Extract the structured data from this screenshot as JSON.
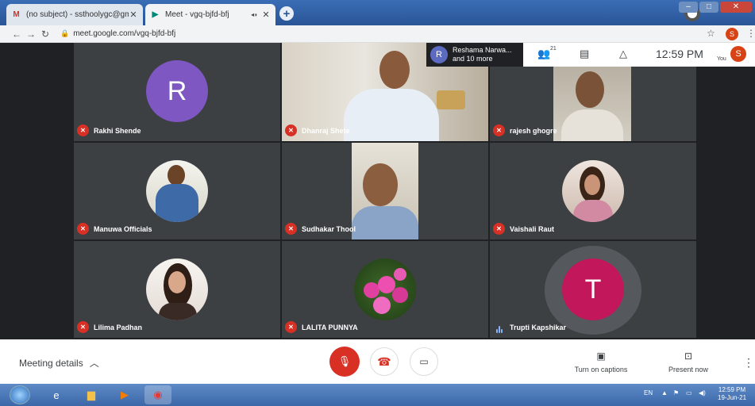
{
  "browser": {
    "tabs": [
      {
        "icon": "gmail-icon",
        "glyph": "M",
        "title": "(no subject) - ssthoolygc@gmail.",
        "close": "✕"
      },
      {
        "icon": "meet-icon",
        "glyph": "▶",
        "title": "Meet - vgq-bjfd-bfj",
        "close": "✕",
        "audio": "◂◗"
      }
    ],
    "new_tab": "+",
    "url": "meet.google.com/vgq-bjfd-bfj",
    "profile_initial": "S"
  },
  "meet": {
    "presenting": {
      "initial": "R",
      "line1": "Reshama Narwa...",
      "line2": "and 10 more"
    },
    "people_count": "21",
    "clock": "12:59 PM",
    "you_label": "You",
    "you_initial": "S",
    "participants": [
      {
        "name": "Rakhi Shende",
        "avatar": "R",
        "avatar_color": "#7e57c2",
        "muted": true
      },
      {
        "name": "Dhanraj Shete",
        "muted": true
      },
      {
        "name": "rajesh ghogre",
        "muted": true
      },
      {
        "name": "Manuwa Officials",
        "muted": true
      },
      {
        "name": "Sudhakar Thool",
        "muted": true
      },
      {
        "name": "Vaishali Raut",
        "muted": true
      },
      {
        "name": "Lilima Padhan",
        "muted": true
      },
      {
        "name": "LALITA PUNNYA",
        "muted": true
      },
      {
        "name": "Trupti Kapshikar",
        "avatar": "T",
        "avatar_color": "#c2185b",
        "muted": false,
        "speaking": true
      }
    ],
    "bottom": {
      "meeting_details": "Meeting details",
      "captions": "Turn on captions",
      "present": "Present now"
    }
  },
  "taskbar": {
    "lang": "EN",
    "time": "12:59 PM",
    "date": "19-Jun-21"
  },
  "colors": {
    "meet_bg": "#202124",
    "tile_bg": "#3c4043",
    "danger": "#d93025"
  }
}
